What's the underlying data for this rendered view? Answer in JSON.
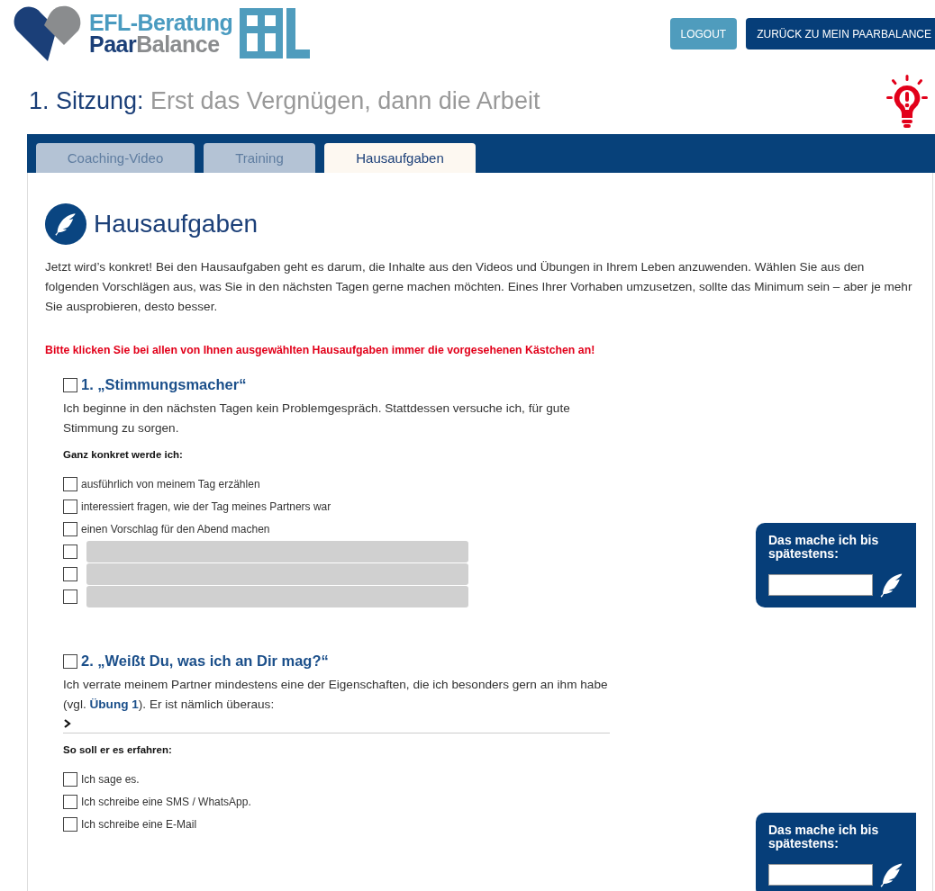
{
  "logo": {
    "line1": "EFL-Beratung",
    "line2_a": "Paar",
    "line2_b": "Balance"
  },
  "header_buttons": [
    {
      "label": "LOGOUT",
      "kind": "light"
    },
    {
      "label": "ZURÜCK ZU MEIN PAARBALANCE",
      "kind": "dark"
    }
  ],
  "page_title": {
    "prefix": "1. Sitzung:",
    "title": "Erst das Vergnügen, dann die Arbeit"
  },
  "tabs": [
    {
      "label": "Coaching-Video",
      "selected": false
    },
    {
      "label": "Training",
      "selected": false
    },
    {
      "label": "Hausaufgaben",
      "selected": true
    }
  ],
  "section": {
    "heading": "Hausaufgaben",
    "intro": "Jetzt wird’s konkret! Bei den Hausaufgaben geht es darum, die Inhalte aus den Videos und Übungen in Ihrem Leben anzuwenden. Wählen Sie aus den folgenden Vorschlägen aus, was Sie in den nächsten Tagen gerne machen möchten. Eines Ihrer Vorhaben umzusetzen, sollte das Minimum sein – aber je mehr Sie ausprobieren, desto besser.",
    "notice": "Bitte klicken Sie bei allen von Ihnen ausgewählten Hausaufgaben immer die vorgesehenen Kästchen an!"
  },
  "tasks": [
    {
      "title": "1. „Stimmungsmacher“",
      "checked": false,
      "text": "Ich beginne in den nächsten Tagen kein Problemgespräch. Stattdessen versuche ich, für gute Stimmung zu sorgen.",
      "subheading": "Ganz konkret werde ich:",
      "options": [
        {
          "kind": "text",
          "label": "ausführlich von meinem Tag erzählen",
          "checked": false
        },
        {
          "kind": "text",
          "label": "interessiert fragen, wie der Tag meines Partners war",
          "checked": false
        },
        {
          "kind": "text",
          "label": "einen Vorschlag für den Abend machen",
          "checked": false
        },
        {
          "kind": "blank",
          "checked": false
        },
        {
          "kind": "blank",
          "checked": false
        },
        {
          "kind": "blank",
          "checked": false
        }
      ],
      "deadline_label": "Das mache ich bis spätestens:"
    },
    {
      "title": "2. „Weißt Du, was ich an Dir mag?“",
      "checked": false,
      "text": "Ich verrate meinem Partner mindestens eine der Eigenschaften, die ich besonders gern an ihm habe (vgl. ",
      "link": "Übung 1",
      "text_after": "). Er ist nämlich überaus:",
      "has_answer_line": true,
      "subheading": "So soll er es erfahren:",
      "options": [
        {
          "kind": "text",
          "label": "Ich sage es.",
          "checked": false
        },
        {
          "kind": "text",
          "label": "Ich schreibe eine SMS / WhatsApp.",
          "checked": false
        },
        {
          "kind": "text",
          "label": "Ich schreibe eine E-Mail",
          "checked": false
        }
      ],
      "deadline_label": "Das mache ich bis spätestens:"
    }
  ]
}
